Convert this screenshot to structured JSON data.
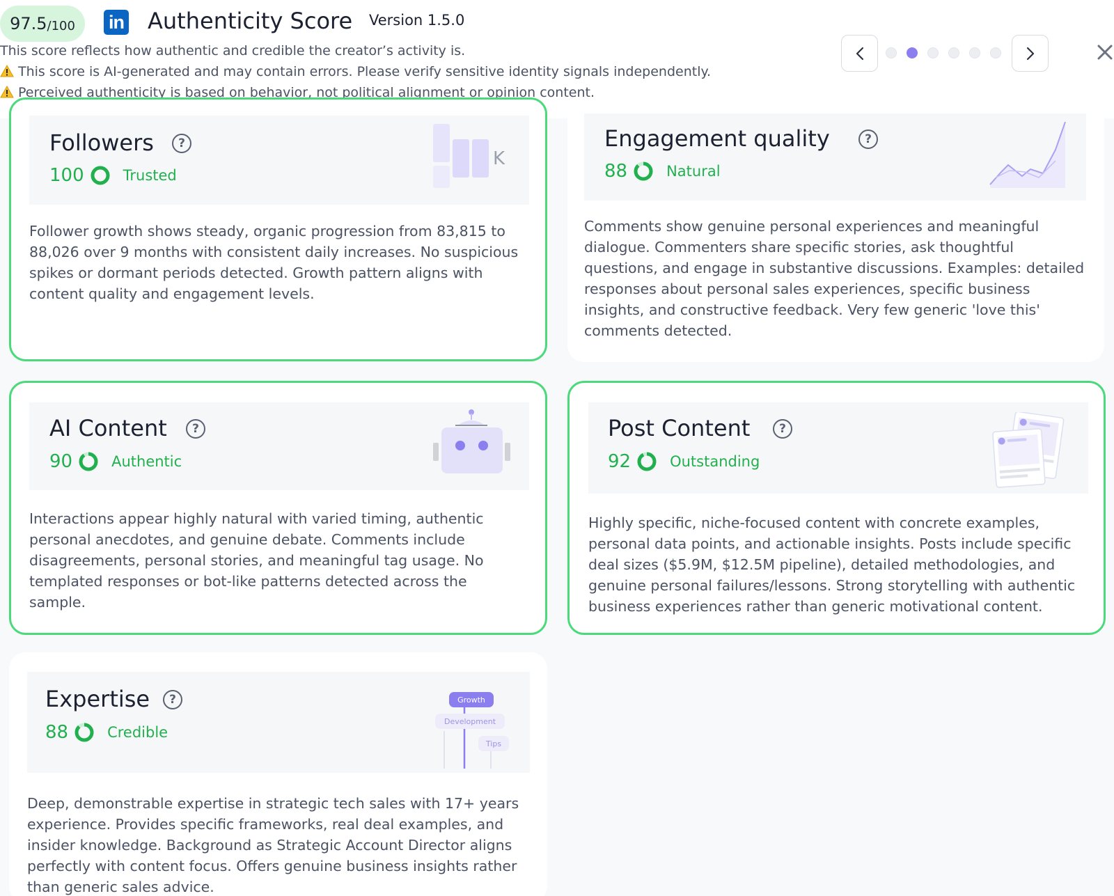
{
  "header": {
    "score_value": "97.5",
    "score_max": "/100",
    "logo_text": "in",
    "title": "Authenticity Score",
    "version": "Version 1.5.0",
    "description": "This score reflects how authentic and credible the creator’s activity is.",
    "warning_1": "This score is AI-generated and may contain errors. Please verify sensitive identity signals independently.",
    "warning_2": "Perceived authenticity is based on behavior, not political alignment or opinion content."
  },
  "pager": {
    "total": 6,
    "active_index": 1
  },
  "icons": {
    "prev": "chevron-left-icon",
    "next": "chevron-right-icon",
    "close": "close-icon",
    "warning": "warning-icon",
    "help": "help-circle-icon"
  },
  "colors": {
    "good": "#22b04f",
    "border": "#4cd97b",
    "accent": "#8b7ff0",
    "linkedin": "#0a66c2"
  },
  "cards": {
    "followers": {
      "title": "Followers",
      "score": "100",
      "score_fraction": 1.0,
      "label": "Trusted",
      "illustration_text": "K",
      "text": "Follower growth shows steady, organic progression from 83,815 to 88,026 over 9 months with consistent daily increases. No suspicious spikes or dormant periods detected. Growth pattern aligns with content quality and engagement levels."
    },
    "engagement": {
      "title": "Engagement quality",
      "score": "88",
      "score_fraction": 0.88,
      "label": "Natural",
      "text": "Comments show genuine personal experiences and meaningful dialogue. Commenters share specific stories, ask thoughtful questions, and engage in substantive discussions. Examples: detailed responses about personal sales experiences, specific business insights, and constructive feedback. Very few generic 'love this' comments detected."
    },
    "ai_content": {
      "title": "AI Content",
      "score": "90",
      "score_fraction": 0.9,
      "label": "Authentic",
      "text": "Interactions appear highly natural with varied timing, authentic personal anecdotes, and genuine debate. Comments include disagreements, personal stories, and meaningful tag usage. No templated responses or bot-like patterns detected across the sample."
    },
    "post_content": {
      "title": "Post Content",
      "score": "92",
      "score_fraction": 0.92,
      "label": "Outstanding",
      "text": "Highly specific, niche-focused content with concrete examples, personal data points, and actionable insights. Posts include specific deal sizes ($5.9M, $12.5M pipeline), detailed methodologies, and genuine personal failures/lessons. Strong storytelling with authentic business experiences rather than generic motivational content."
    },
    "expertise": {
      "title": "Expertise",
      "score": "88",
      "score_fraction": 0.88,
      "label": "Credible",
      "tags": [
        "Growth",
        "Development",
        "Tips"
      ],
      "text": "Deep, demonstrable expertise in strategic tech sales with 17+ years experience. Provides specific frameworks, real deal examples, and insider knowledge. Background as Strategic Account Director aligns perfectly with content focus. Offers genuine business insights rather than generic sales advice."
    }
  }
}
